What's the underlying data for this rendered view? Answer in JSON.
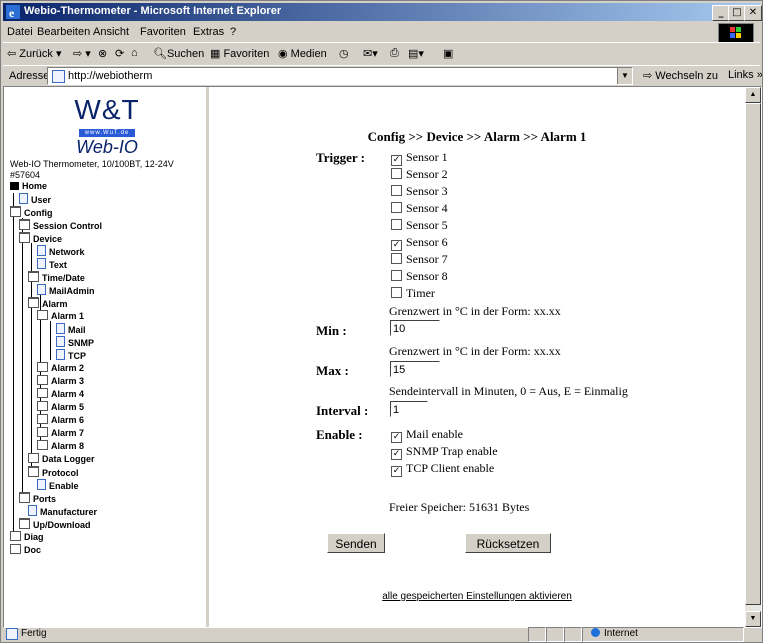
{
  "window": {
    "title": "Webio-Thermometer - Microsoft Internet Explorer"
  },
  "menu": [
    "Datei",
    "Bearbeiten",
    "Ansicht",
    "Favoriten",
    "Extras",
    "?"
  ],
  "toolbar": {
    "back": "⇦ Zurück ▾",
    "forward": "⇨ ▾",
    "search": "Suchen",
    "favorites": "Favoriten",
    "media": "Medien"
  },
  "address": {
    "label": "Adresse",
    "value": "http://webiotherm",
    "go": "Wechseln zu",
    "links": "Links »"
  },
  "sidebar": {
    "logo_text": "W&T",
    "logo_url": "www.WuT.de",
    "logo_product": "Web-IO",
    "device_line1": "Web-IO Thermometer, 10/100BT, 12-24V",
    "device_line2": "#57604",
    "tree": [
      {
        "label": "Home",
        "icon": "home"
      },
      {
        "label": "User",
        "icon": "doc"
      },
      {
        "label": "Config",
        "icon": "folder"
      },
      {
        "label": "Session Control",
        "icon": "folder"
      },
      {
        "label": "Device",
        "icon": "folder"
      },
      {
        "label": "Network",
        "icon": "doc"
      },
      {
        "label": "Text",
        "icon": "doc"
      },
      {
        "label": "Time/Date",
        "icon": "folder"
      },
      {
        "label": "MailAdmin",
        "icon": "doc"
      },
      {
        "label": "Alarm",
        "icon": "folder"
      },
      {
        "label": "Alarm 1",
        "icon": "book"
      },
      {
        "label": "Mail",
        "icon": "doc"
      },
      {
        "label": "SNMP",
        "icon": "doc"
      },
      {
        "label": "TCP",
        "icon": "doc"
      },
      {
        "label": "Alarm 2",
        "icon": "book"
      },
      {
        "label": "Alarm 3",
        "icon": "book"
      },
      {
        "label": "Alarm 4",
        "icon": "book"
      },
      {
        "label": "Alarm 5",
        "icon": "book"
      },
      {
        "label": "Alarm 6",
        "icon": "book"
      },
      {
        "label": "Alarm 7",
        "icon": "book"
      },
      {
        "label": "Alarm 8",
        "icon": "book"
      },
      {
        "label": "Data Logger",
        "icon": "book"
      },
      {
        "label": "Protocol",
        "icon": "folder"
      },
      {
        "label": "Enable",
        "icon": "doc"
      },
      {
        "label": "Ports",
        "icon": "folder"
      },
      {
        "label": "Manufacturer",
        "icon": "doc"
      },
      {
        "label": "Up/Download",
        "icon": "folder"
      },
      {
        "label": "Diag",
        "icon": "book"
      },
      {
        "label": "Doc",
        "icon": "book"
      }
    ]
  },
  "main": {
    "breadcrumb": "Config >> Device >> Alarm >> Alarm 1",
    "trigger_label": "Trigger :",
    "triggers": [
      {
        "label": "Sensor 1",
        "checked": true
      },
      {
        "label": "Sensor 2",
        "checked": false
      },
      {
        "label": "Sensor 3",
        "checked": false
      },
      {
        "label": "Sensor 4",
        "checked": false
      },
      {
        "label": "Sensor 5",
        "checked": false
      },
      {
        "label": "Sensor 6",
        "checked": true
      },
      {
        "label": "Sensor 7",
        "checked": false
      },
      {
        "label": "Sensor 8",
        "checked": false
      },
      {
        "label": "Timer",
        "checked": false
      }
    ],
    "min_hint": "Grenzwert in °C in der Form: xx.xx",
    "min_label": "Min :",
    "min_value": "10",
    "max_hint": "Grenzwert in °C in der Form: xx.xx",
    "max_label": "Max :",
    "max_value": "15",
    "interval_hint": "Sendeintervall in Minuten, 0 = Aus, E = Einmalig",
    "interval_label": "Interval :",
    "interval_value": "1",
    "enable_label": "Enable :",
    "enables": [
      {
        "label": "Mail enable",
        "checked": true
      },
      {
        "label": "SNMP Trap enable",
        "checked": true
      },
      {
        "label": "TCP Client enable",
        "checked": true
      }
    ],
    "free_memory": "Freier Speicher: 51631 Bytes",
    "send_button": "Senden",
    "reset_button": "Rücksetzen",
    "activate_link": "alle gespeicherten Einstellungen aktivieren"
  },
  "status": {
    "text": "Fertig",
    "zone": "Internet"
  }
}
